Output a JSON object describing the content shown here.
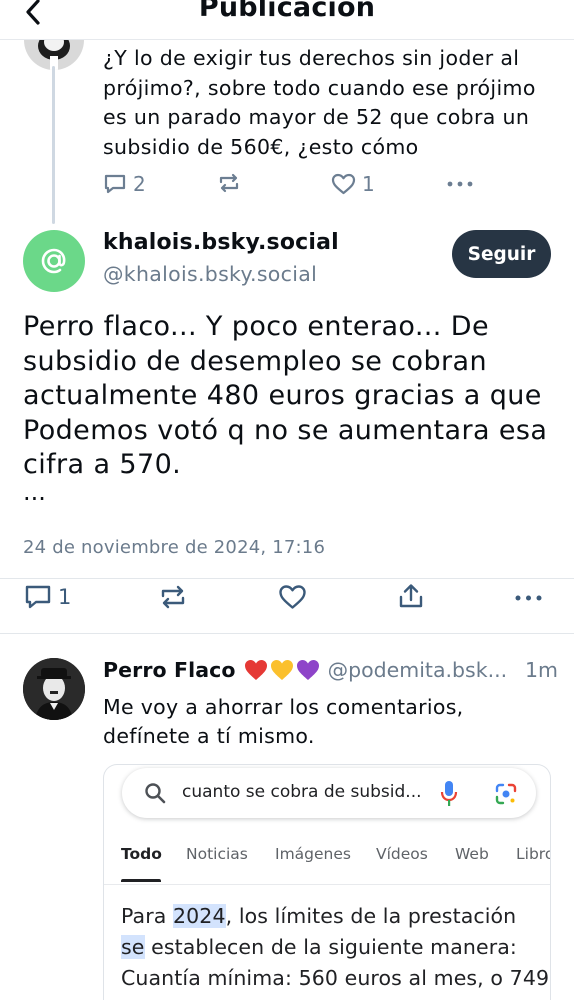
{
  "header": {
    "title": "Publicación"
  },
  "parent_post": {
    "text": "¿Y lo de exigir tus derechos sin joder al prójimo?, sobre todo cuando ese prójimo es un parado mayor de 52 que cobra un subsidio de 560€, ¿esto cómo",
    "reply_count": "2",
    "like_count": "1"
  },
  "main_post": {
    "author_name": "khalois.bsky.social",
    "author_handle": "@khalois.bsky.social",
    "follow_label": "Seguir",
    "text": "Perro flaco... Y poco enterao... De subsidio de desempleo se cobran actualmente 480 euros gracias a que Podemos votó q no se aumentara esa cifra a 570.",
    "ellipsis": "...",
    "date": "24 de noviembre de 2024, 17:16",
    "reply_count": "1"
  },
  "reply": {
    "author_name": "Perro Flaco",
    "handle": "@podemita.bsk...",
    "time": "1m",
    "text": "Me voy a ahorrar los comentarios, defínete a tí mismo.",
    "embed": {
      "search_query": "cuanto se cobra de subsid...",
      "tabs": [
        "Todo",
        "Noticias",
        "Imágenes",
        "Vídeos",
        "Web",
        "Libro"
      ],
      "body_line1_pre": "Para ",
      "body_line1_hl": "2024",
      "body_line1_post": ", los límites de la prestación",
      "body_line2_hl": "se",
      "body_line2_post": " establecen de la siguiente manera:",
      "body_line3": "Cuantía mínima: 560 euros al mes, o 749"
    }
  },
  "colors": {
    "follow_bg": "#273544",
    "avatar_green": "#6bd889",
    "muted": "#6b7b8c",
    "highlight": "#d3e3fd"
  }
}
